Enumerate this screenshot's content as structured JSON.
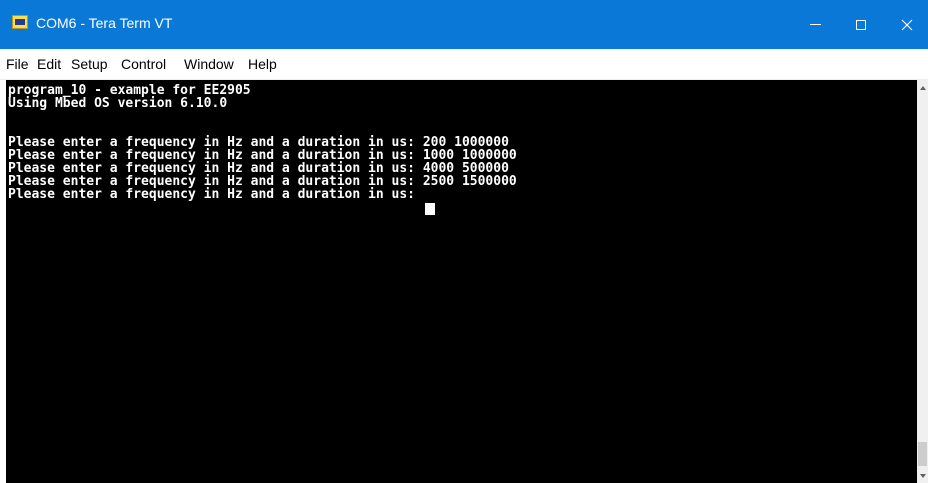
{
  "window": {
    "title": "COM6 - Tera Term VT",
    "icon": "tera-term-icon"
  },
  "menu": {
    "file": "File",
    "edit": "Edit",
    "setup": "Setup",
    "control": "Control",
    "window": "Window",
    "help": "Help"
  },
  "terminal": {
    "lines": [
      "program_10 - example for EE2905",
      "Using Mbed OS version 6.10.0",
      "",
      "Please enter a frequency in Hz and a duration in us: 200 1000000",
      "Please enter a frequency in Hz and a duration in us: 1000 1000000",
      "Please enter a frequency in Hz and a duration in us: 4000 500000",
      "Please enter a frequency in Hz and a duration in us: 2500 1500000",
      "Please enter a frequency in Hz and a duration in us: "
    ]
  },
  "colors": {
    "titlebar": "#0a78d7",
    "terminal_bg": "#000000",
    "terminal_fg": "#ffffff"
  }
}
